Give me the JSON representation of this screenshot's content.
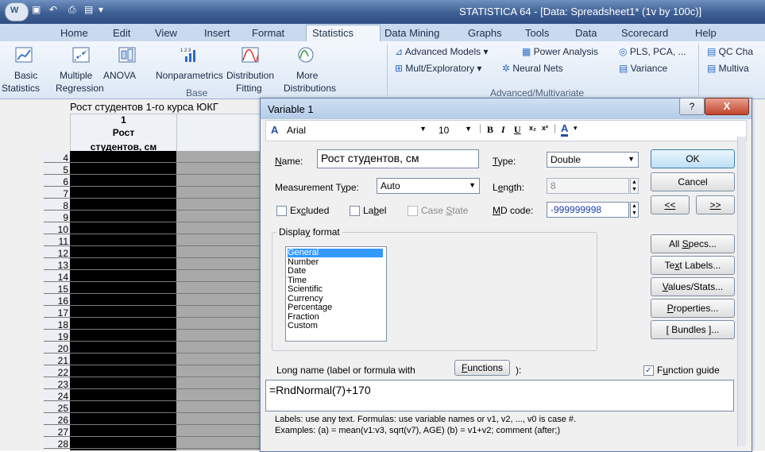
{
  "window": {
    "title": "STATISTICA 64 - [Data: Spreadsheet1* (1v by 100c)]"
  },
  "menu_tabs": [
    "Home",
    "Edit",
    "View",
    "Insert",
    "Format",
    "Statistics",
    "Data Mining",
    "Graphs",
    "Tools",
    "Data",
    "Scorecard",
    "Help"
  ],
  "ribbon": {
    "base_buttons": {
      "basic": [
        "Basic",
        "Statistics"
      ],
      "multiple": [
        "Multiple",
        "Regression"
      ],
      "anova": "ANOVA",
      "nonparametrics": "Nonparametrics",
      "distribution": [
        "Distribution",
        "Fitting"
      ],
      "more": [
        "More",
        "Distributions"
      ]
    },
    "base_group_label": "Base",
    "advanced_items": [
      "Advanced Models",
      "Power Analysis",
      "PLS, PCA, ...",
      "Mult/Exploratory",
      "Neural Nets",
      "Variance"
    ],
    "advanced_group_label": "Advanced/Multivariate",
    "qc_items": [
      "QC Cha",
      "Multiva"
    ]
  },
  "spreadsheet": {
    "column_title": "Рост студентов 1-го курса ЮКГ",
    "column_number": "1",
    "column_name_line1": "Рост",
    "column_name_line2": "студентов, см",
    "row_numbers": [
      "4",
      "5",
      "6",
      "7",
      "8",
      "9",
      "10",
      "11",
      "12",
      "13",
      "14",
      "15",
      "16",
      "17",
      "18",
      "19",
      "20",
      "21",
      "22",
      "23",
      "24",
      "25",
      "26",
      "27",
      "28"
    ]
  },
  "dialog": {
    "title": "Variable 1",
    "help_label": "?",
    "close_label": "X",
    "font_name": "Arial",
    "font_size": "10",
    "name_label": "Name:",
    "name_value": "Рост студентов, см",
    "type_label": "Type:",
    "type_value": "Double",
    "measurement_label": "Measurement Type:",
    "measurement_value": "Auto",
    "length_label": "Length:",
    "length_value": "8",
    "excluded_label": "Excluded",
    "label_label": "Label",
    "case_state_label": "Case State",
    "md_code_label": "MD code:",
    "md_code_value": "-999999998",
    "display_format_label": "Display format",
    "display_formats": [
      "General",
      "Number",
      "Date",
      "Time",
      "Scientific",
      "Currency",
      "Percentage",
      "Fraction",
      "Custom"
    ],
    "selected_format": "General",
    "ok_label": "OK",
    "cancel_label": "Cancel",
    "prev_label": "<<",
    "next_label": ">>",
    "all_specs_label": "All Specs...",
    "text_labels_label": "Text Labels...",
    "values_stats_label": "Values/Stats...",
    "properties_label": "Properties...",
    "bundles_label": "[ Bundles ]...",
    "long_name_label": "Long name (label or formula with",
    "functions_label": "Functions",
    "long_name_suffix": "):",
    "function_guide_label": "Function guide",
    "function_guide_checked": true,
    "formula": "=RndNormal(7)+170",
    "note_line1": "Labels: use any text. Formulas: use variable names or v1, v2, ..., v0 is case #.",
    "note_line2": "Examples: (a) = mean(v1:v3, sqrt(v7), AGE) (b) = v1+v2; comment (after;)"
  }
}
